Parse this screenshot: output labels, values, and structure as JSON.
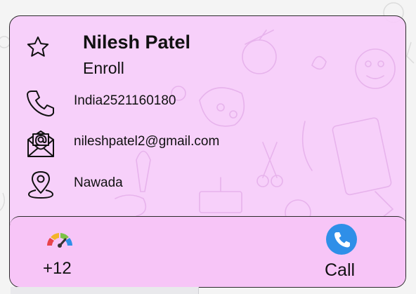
{
  "contact": {
    "name": "Nilesh Patel",
    "subtitle": "Enroll",
    "phone": "India2521160180",
    "email": "nileshpatel2@gmail.com",
    "location": "Nawada"
  },
  "footer": {
    "gauge_count": "+12",
    "call_label": "Call"
  },
  "icons": {
    "favorite": "star-outline-icon",
    "phone": "phone-icon",
    "email": "envelope-at-icon",
    "location": "map-pin-icon",
    "score": "gauge-icon",
    "call": "phone-circle-icon"
  },
  "colors": {
    "card_background": "#f6cdfa",
    "footer_background": "#f7c5f7",
    "call_button": "#2f8fe8",
    "gauge_segments": [
      "#e8434a",
      "#f3b42b",
      "#7cc247",
      "#2f8fe8"
    ]
  }
}
